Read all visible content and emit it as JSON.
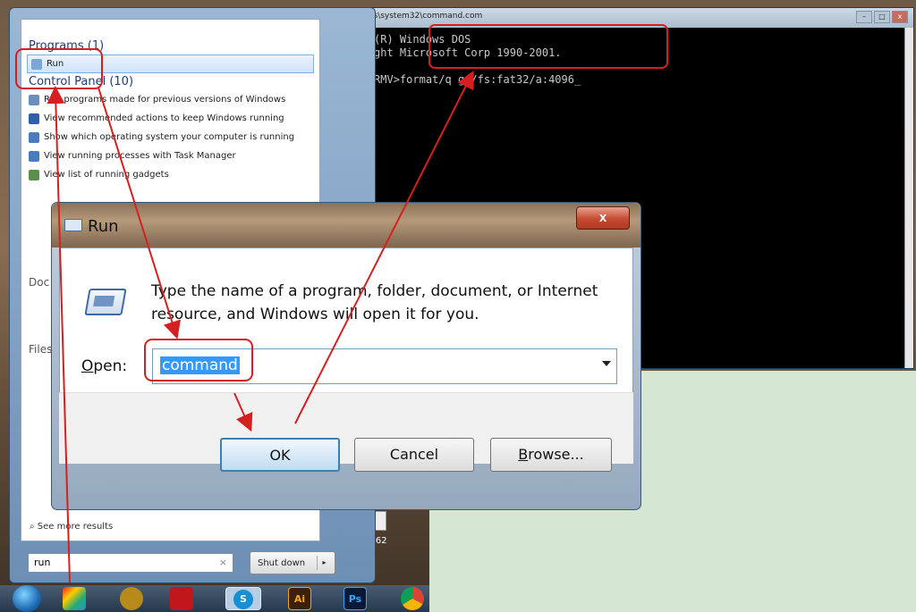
{
  "start_menu": {
    "programs_header": "Programs (1)",
    "run_item": "Run",
    "control_panel_header": "Control Panel (10)",
    "control_panel_items": [
      "Run programs made for previous versions of Windows",
      "View recommended actions to keep Windows running",
      "Show which operating system your computer is running",
      "View running processes with Task Manager",
      "View list of running gadgets"
    ],
    "documents_header": "Doc",
    "files_header": "Files",
    "see_more": "See more results",
    "search_value": "run",
    "search_clear": "×",
    "shutdown_label": "Shut down",
    "shutdown_arrow": "▸"
  },
  "cmd": {
    "title": "C:\\windows\\system32\\command.com",
    "line1": "Microsoft(R) Windows DOS",
    "line2": "(C)Copyright Microsoft Corp 1990-2001.",
    "line3": "C:\\USERS\\RMV>format/q g:/fs:fat32/a:4096_",
    "min": "–",
    "max": "□",
    "close": "x"
  },
  "run_dialog": {
    "title": "Run",
    "close": "x",
    "description": "Type the name of a program, folder, document, or Internet resource, and Windows will open it for you.",
    "open_label_first": "O",
    "open_label_rest": "pen:",
    "input_value": "command",
    "ok": "OK",
    "cancel": "Cancel",
    "browse_first": "B",
    "browse_rest": "rowse..."
  },
  "desktop": {
    "icon_label": "_V62"
  },
  "taskbar": {
    "items": [
      "start",
      "app",
      "yahoo",
      "adobe",
      "skype",
      "Ai",
      "Ps",
      "chrome"
    ],
    "ai_label": "Ai",
    "ps_label": "Ps"
  },
  "colors": {
    "annotation": "#d62020",
    "selection": "#3399ff"
  }
}
